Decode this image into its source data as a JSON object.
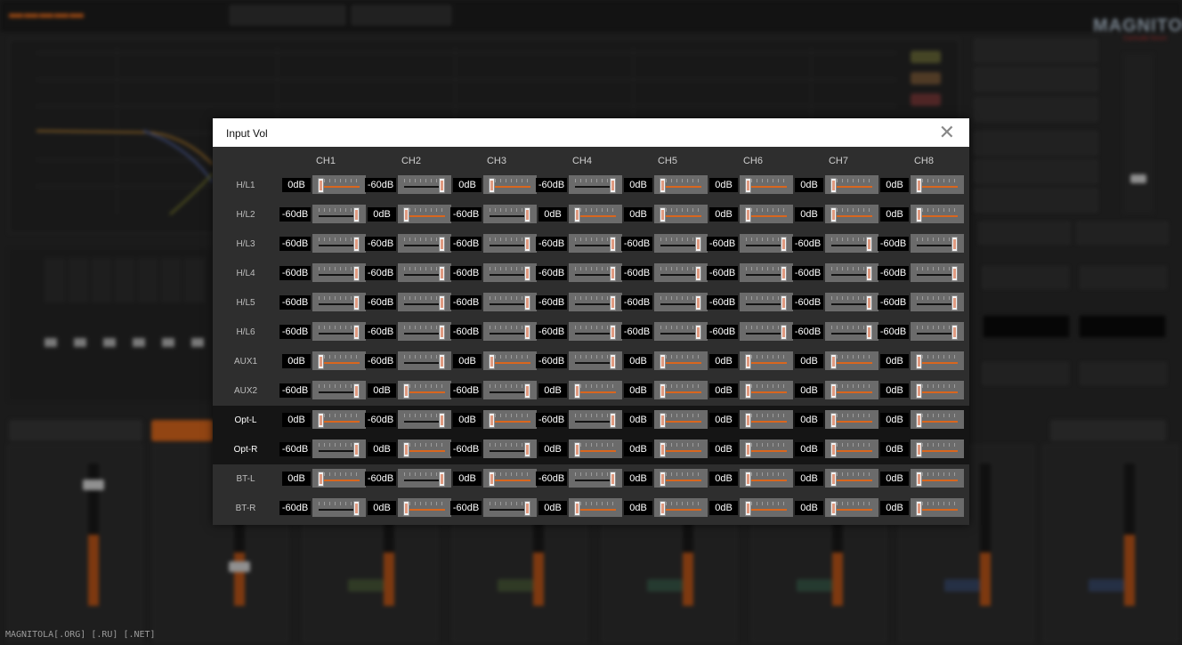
{
  "background": {
    "watermark": "MAGNITOLA[.ORG] [.RU] [.NET]",
    "brand": "MAGNITOLA",
    "brand_sub": "CarAudio forum"
  },
  "dialog": {
    "title": "Input Vol",
    "close_glyph": "✕",
    "columns": [
      "CH1",
      "CH2",
      "CH3",
      "CH4",
      "CH5",
      "CH6",
      "CH7",
      "CH8"
    ],
    "rows": [
      {
        "label": "H/L1",
        "values": [
          "0dB",
          "-60dB",
          "0dB",
          "-60dB",
          "0dB",
          "0dB",
          "0dB",
          "0dB"
        ]
      },
      {
        "label": "H/L2",
        "values": [
          "-60dB",
          "0dB",
          "-60dB",
          "0dB",
          "0dB",
          "0dB",
          "0dB",
          "0dB"
        ]
      },
      {
        "label": "H/L3",
        "values": [
          "-60dB",
          "-60dB",
          "-60dB",
          "-60dB",
          "-60dB",
          "-60dB",
          "-60dB",
          "-60dB"
        ]
      },
      {
        "label": "H/L4",
        "values": [
          "-60dB",
          "-60dB",
          "-60dB",
          "-60dB",
          "-60dB",
          "-60dB",
          "-60dB",
          "-60dB"
        ]
      },
      {
        "label": "H/L5",
        "values": [
          "-60dB",
          "-60dB",
          "-60dB",
          "-60dB",
          "-60dB",
          "-60dB",
          "-60dB",
          "-60dB"
        ]
      },
      {
        "label": "H/L6",
        "values": [
          "-60dB",
          "-60dB",
          "-60dB",
          "-60dB",
          "-60dB",
          "-60dB",
          "-60dB",
          "-60dB"
        ]
      },
      {
        "label": "AUX1",
        "values": [
          "0dB",
          "-60dB",
          "0dB",
          "-60dB",
          "0dB",
          "0dB",
          "0dB",
          "0dB"
        ]
      },
      {
        "label": "AUX2",
        "values": [
          "-60dB",
          "0dB",
          "-60dB",
          "0dB",
          "0dB",
          "0dB",
          "0dB",
          "0dB"
        ]
      },
      {
        "label": "Opt-L",
        "values": [
          "0dB",
          "-60dB",
          "0dB",
          "-60dB",
          "0dB",
          "0dB",
          "0dB",
          "0dB"
        ]
      },
      {
        "label": "Opt-R",
        "values": [
          "-60dB",
          "0dB",
          "-60dB",
          "0dB",
          "0dB",
          "0dB",
          "0dB",
          "0dB"
        ]
      },
      {
        "label": "BT-L",
        "values": [
          "0dB",
          "-60dB",
          "0dB",
          "-60dB",
          "0dB",
          "0dB",
          "0dB",
          "0dB"
        ]
      },
      {
        "label": "BT-R",
        "values": [
          "-60dB",
          "0dB",
          "-60dB",
          "0dB",
          "0dB",
          "0dB",
          "0dB",
          "0dB"
        ]
      }
    ],
    "highlighted_rows": [
      "Opt-L",
      "Opt-R"
    ]
  },
  "colors": {
    "accent_orange": "#d9661e",
    "title_bar": "#ffffff",
    "dialog_bg": "#2e2e2e"
  }
}
